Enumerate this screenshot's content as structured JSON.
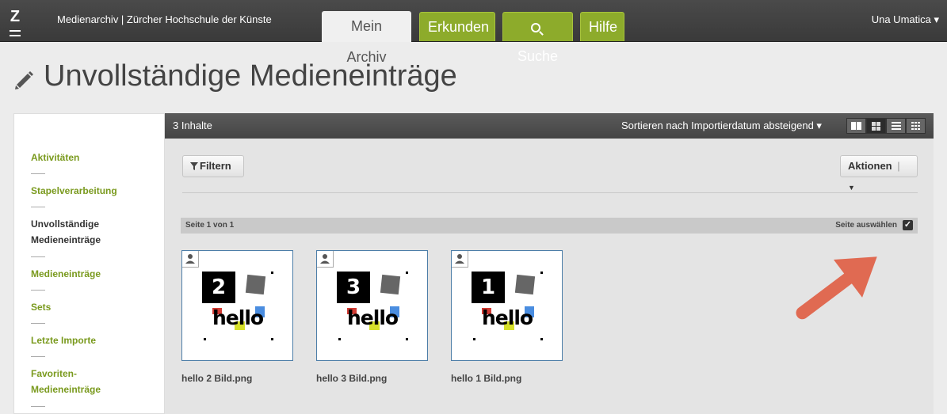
{
  "topbar": {
    "logo_letter": "Z",
    "app_title": "Medienarchiv | Zürcher Hochschule der Künste",
    "tabs": [
      {
        "label": "Mein Archiv",
        "active": true
      },
      {
        "label": "Erkunden",
        "active": false
      },
      {
        "label": "Suche",
        "active": false,
        "icon": "search-icon"
      },
      {
        "label": "Hilfe",
        "active": false
      }
    ],
    "user_name": "Una Umatica ▾"
  },
  "page": {
    "title": "Unvollständige Medieneinträge",
    "title_icon": "pencil-icon"
  },
  "sidebar": {
    "items": [
      {
        "label": "Aktivitäten",
        "active": false
      },
      {
        "label": "Stapelverarbeitung",
        "active": false
      },
      {
        "label_line1": "Unvollständige",
        "label_line2": "Medieneinträge",
        "active": true
      },
      {
        "label": "Medieneinträge",
        "active": false
      },
      {
        "label": "Sets",
        "active": false
      },
      {
        "label": "Letzte Importe",
        "active": false
      },
      {
        "label_line1": "Favoriten-",
        "label_line2": "Medieneinträge",
        "active": false
      }
    ]
  },
  "content": {
    "count_label": "3 Inhalte",
    "sort_label": "Sortieren nach Importierdatum absteigend ▾",
    "view_modes": [
      "columns-icon",
      "grid-icon",
      "list-icon",
      "tiles-icon"
    ],
    "active_view": "grid-icon",
    "filter_label": "Filtern",
    "actions_label": "Aktionen",
    "page_label": "Seite 1 von 1",
    "select_page_label": "Seite auswählen",
    "select_page_checked": true,
    "items": [
      {
        "number": "2",
        "hello": "hello",
        "filename": "hello 2 Bild.png"
      },
      {
        "number": "3",
        "hello": "hello",
        "filename": "hello 3 Bild.png"
      },
      {
        "number": "1",
        "hello": "hello",
        "filename": "hello 1 Bild.png"
      }
    ]
  },
  "colors": {
    "accent_green": "#8dab2b",
    "link_green": "#7a9a1e",
    "arrow": "#e06a52"
  }
}
